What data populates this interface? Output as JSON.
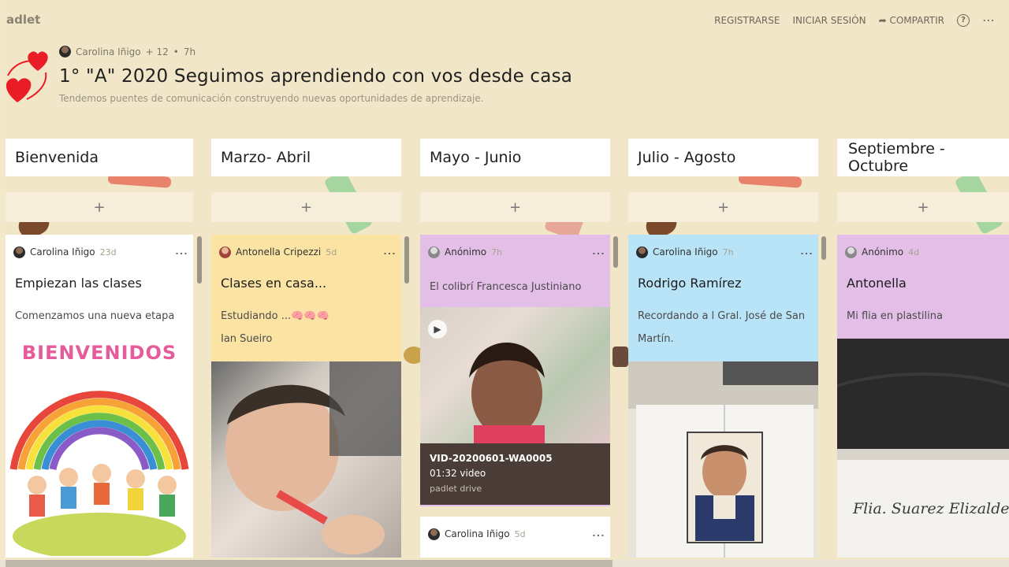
{
  "app": {
    "logo": "adlet"
  },
  "nav": {
    "register": "REGISTRARSE",
    "login": "INICIAR SESIÓN",
    "share": "COMPARTIR",
    "share_icon": "share-arrow-icon",
    "help": "?",
    "more": "⋯"
  },
  "header": {
    "author": "Carolina Iñigo",
    "likes": "+ 12",
    "dot": "•",
    "age": "7h",
    "title": "1° \"A\" 2020 Seguimos aprendiendo con vos desde casa",
    "subtitle": "Tendemos puentes de comunicación construyendo nuevas oportunidades de aprendizaje."
  },
  "columns": [
    {
      "label": "Bienvenida",
      "add": "+"
    },
    {
      "label": "Marzo- Abril",
      "add": "+"
    },
    {
      "label": "Mayo - Junio",
      "add": "+"
    },
    {
      "label": "Julio - Agosto",
      "add": "+"
    },
    {
      "label": "Septiembre - Octubre",
      "add": "+"
    }
  ],
  "cards": [
    {
      "author": "Carolina Iñigo",
      "time": "23d",
      "title": "Empiezan las clases",
      "body": [
        "Comenzamos una nueva etapa"
      ],
      "image_text": "BIENVENIDOS",
      "bg": "#ffffff"
    },
    {
      "author": "Antonella Cripezzi",
      "time": "5d",
      "title": "Clases en casa...",
      "body": [
        "Estudiando ...🧠🧠🧠",
        "Ian Sueiro"
      ],
      "bg": "#fbe4a3"
    },
    {
      "author": "Anónimo",
      "time": "7h",
      "title": "",
      "body": [
        "El colibrí  Francesca Justiniano"
      ],
      "video": {
        "name": "VID-20200601-WA0005",
        "meta": "01:32 video",
        "source": "padlet drive"
      },
      "next_author": "Carolina Iñigo",
      "next_time": "5d",
      "bg": "#e3bfe8"
    },
    {
      "author": "Carolina Iñigo",
      "time": "7h",
      "title": "Rodrigo Ramírez",
      "body": [
        "Recordando a l Gral. José de San",
        "Martín."
      ],
      "bg": "#b9e3f6"
    },
    {
      "author": "Anónimo",
      "time": "4d",
      "title": "Antonella",
      "body": [
        "Mi flia en plastilina"
      ],
      "image_text": "Flia. Suarez Elizaldes",
      "bg": "#e3bfe8"
    }
  ],
  "menu_icon": "⋮"
}
